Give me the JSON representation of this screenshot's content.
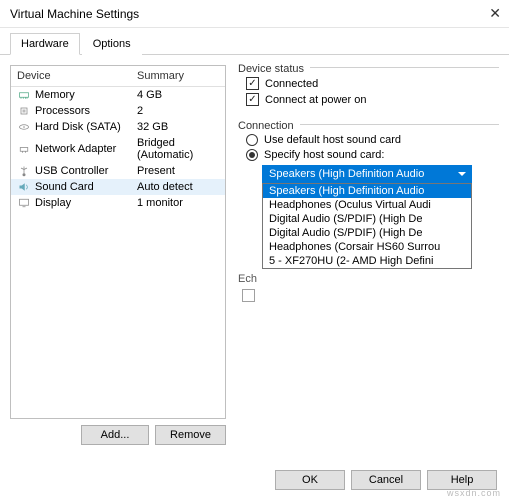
{
  "window": {
    "title": "Virtual Machine Settings",
    "close": "✕"
  },
  "tabs": {
    "hardware": "Hardware",
    "options": "Options"
  },
  "device_header": {
    "device": "Device",
    "summary": "Summary"
  },
  "devices": [
    {
      "icon": "memory",
      "name": "Memory",
      "summary": "4 GB"
    },
    {
      "icon": "cpu",
      "name": "Processors",
      "summary": "2"
    },
    {
      "icon": "disk",
      "name": "Hard Disk (SATA)",
      "summary": "32 GB"
    },
    {
      "icon": "net",
      "name": "Network Adapter",
      "summary": "Bridged (Automatic)"
    },
    {
      "icon": "usb",
      "name": "USB Controller",
      "summary": "Present"
    },
    {
      "icon": "sound",
      "name": "Sound Card",
      "summary": "Auto detect"
    },
    {
      "icon": "display",
      "name": "Display",
      "summary": "1 monitor"
    }
  ],
  "left_buttons": {
    "add": "Add...",
    "remove": "Remove"
  },
  "device_status": {
    "label": "Device status",
    "connected": "Connected",
    "connect_power": "Connect at power on"
  },
  "connection": {
    "label": "Connection",
    "use_default": "Use default host sound card",
    "specify": "Specify host sound card:",
    "selected": "Speakers (High Definition Audio",
    "options": [
      "Speakers (High Definition Audio",
      "Headphones (Oculus Virtual Audi",
      "Digital Audio (S/PDIF) (High De",
      "Digital Audio (S/PDIF) (High De",
      "Headphones (Corsair HS60 Surrou",
      "5 - XF270HU (2- AMD High Defini"
    ]
  },
  "echo": {
    "prefix": "Ech",
    "label_remainder": ""
  },
  "footer": {
    "ok": "OK",
    "cancel": "Cancel",
    "help": "Help"
  },
  "watermark": "wsxdn.com"
}
